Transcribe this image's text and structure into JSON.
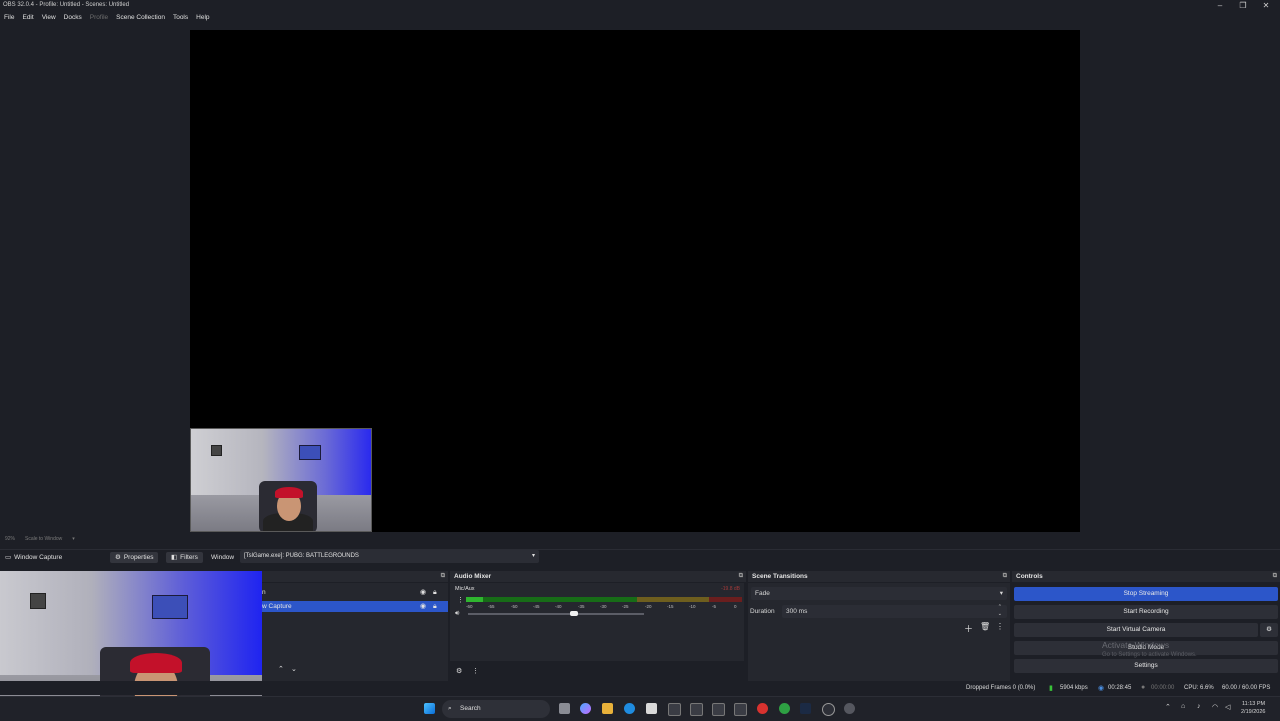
{
  "window": {
    "title": "OBS 32.0.4 - Profile: Untitled - Scenes: Untitled",
    "minimize": "–",
    "maximize": "❐",
    "close": "✕"
  },
  "menu": [
    "File",
    "Edit",
    "View",
    "Docks",
    "Profile",
    "Scene Collection",
    "Tools",
    "Help"
  ],
  "preview": {
    "zoom": "92%",
    "scale_mode": "Scale to Window"
  },
  "source_bar": {
    "source_name": "Window Capture",
    "properties": "Properties",
    "filters": "Filters",
    "window_label": "Window",
    "window_value": "[TslGame.exe]: PUBG: BATTLEGROUNDS"
  },
  "sources": {
    "rows": [
      "n",
      "w Capture"
    ]
  },
  "audio_mixer": {
    "title": "Audio Mixer",
    "channel_name": "Mic/Aux",
    "db_value": "-19.8 dB",
    "scale": [
      "-60",
      "-55",
      "-50",
      "-45",
      "-40",
      "-35",
      "-30",
      "-25",
      "-20",
      "-15",
      "-10",
      "-5",
      "0"
    ],
    "level_fraction": 0.06,
    "volume_fraction": 0.6
  },
  "scene_transitions": {
    "title": "Scene Transitions",
    "transition": "Fade",
    "duration_label": "Duration",
    "duration_value": "300 ms"
  },
  "controls": {
    "title": "Controls",
    "stop_streaming": "Stop Streaming",
    "start_recording": "Start Recording",
    "start_virtual_camera": "Start Virtual Camera",
    "studio_mode": "Studio Mode",
    "settings": "Settings",
    "watermark_title": "Activate Windows",
    "watermark_sub": "Go to Settings to activate Windows."
  },
  "status": {
    "dropped_frames": "Dropped Frames 0 (0.0%)",
    "bitrate": "5904 kbps",
    "stream_time": "00:28:45",
    "record_time": "00:00:00",
    "cpu": "CPU: 6.6%",
    "fps": "60.00 / 60.00 FPS"
  },
  "taskbar": {
    "search": "Search",
    "time": "11:13 PM",
    "date": "2/19/2026"
  },
  "colors": {
    "accent": "#2c56c9",
    "meter_green": "#2fb52f",
    "meter_yellow": "#a08a2a",
    "meter_red": "#9b2a2a"
  }
}
